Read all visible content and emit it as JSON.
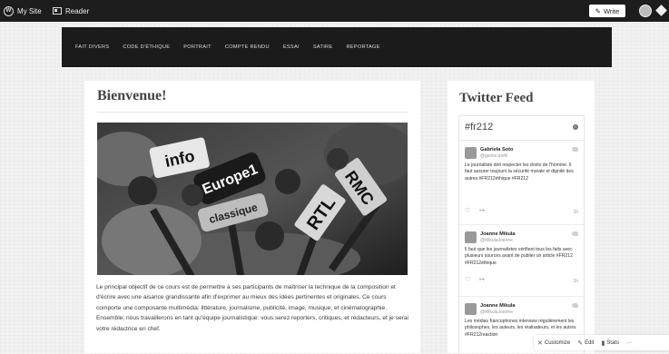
{
  "admin_bar": {
    "my_site": "My Site",
    "reader": "Reader",
    "write": "Write"
  },
  "nav": {
    "items": [
      "FAIT DIVERS",
      "CODE D'ÉTHIQUE",
      "PORTRAIT",
      "COMPTE RENDU",
      "ESSAI",
      "SATIRE",
      "REPORTAGE"
    ]
  },
  "page": {
    "title": "Bienvenue!",
    "image_signs": [
      "info",
      "Europe1",
      "classique",
      "RTL",
      "RMC"
    ],
    "body": "Le principal objectif de ce cours est de permettre à ses participants de maîtriser la technique de la composition et d'écrire avec une aisance grandissante afin d'exprimer au mieux des idées pertinentes et originales. Ce cours comporte une composante multimédia: littérature, journalisme, publicité, image, musique, et cinématographie. Ensemble, nous travaillerons en tant qu'équipe journalistique: vous serez reporters, critiques, et rédacteurs, et je serai votre rédactrice en chef."
  },
  "widget": {
    "title": "Twitter Feed",
    "hashtag": "#fr212",
    "info_glyph": "i",
    "tweets": [
      {
        "name": "Gabriela Soto",
        "handle": "@gsotocarelli",
        "text": "Le journaliste doit respecter les droits de l'homme. Il faut assurer toujours la sécurité morale et dignité des autres #FR212éthique #FR212",
        "time": "1h"
      },
      {
        "name": "Joanne Mikula",
        "handle": "@MikulaJoanne",
        "text": "Il faut que les journalistes vérifient tous les faits avec plusieurs sources avant de publier un article #FR212 #FR212éthique",
        "time": "1h"
      },
      {
        "name": "Joanne Mikula",
        "handle": "@MikulaJoanne",
        "text": "Les médias francophones interview régulièrement les philosophes, les auteurs, les réalisateurs, et les autres #FR212reaction",
        "time": ""
      }
    ],
    "like_glyph": "♡",
    "reply_glyph": "↦"
  },
  "customize_bar": {
    "customize": "Customize",
    "edit": "Edit",
    "stats": "Stats",
    "more": "···"
  }
}
